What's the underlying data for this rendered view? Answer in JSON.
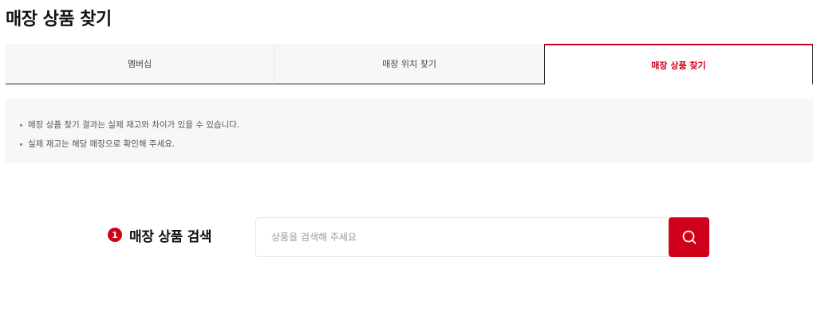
{
  "page": {
    "title": "매장 상품 찾기"
  },
  "tabs": [
    {
      "label": "멤버십",
      "active": false
    },
    {
      "label": "매장 위치 찾기",
      "active": false
    },
    {
      "label": "매장 상품 찾기",
      "active": true
    }
  ],
  "notice": {
    "items": [
      "매장 상품 찾기 결과는 실제 재고와 차이가 있을 수 있습니다.",
      "실제 재고는 해당 매장으로 확인해 주세요."
    ]
  },
  "search": {
    "step_number": "1",
    "label": "매장 상품 검색",
    "value": "",
    "placeholder": "상품을 검색해 주세요",
    "button_icon": "search-icon"
  },
  "colors": {
    "accent": "#d0021b",
    "notice_bg": "#f7f7f7",
    "tab_bg": "#f7f7f7"
  }
}
